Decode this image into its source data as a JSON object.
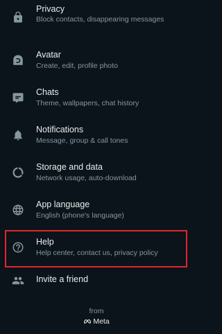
{
  "settings": {
    "items": [
      {
        "title": "Privacy",
        "subtitle": "Block contacts, disappearing messages",
        "icon": "lock-icon"
      },
      {
        "title": "Avatar",
        "subtitle": "Create, edit, profile photo",
        "icon": "avatar-icon"
      },
      {
        "title": "Chats",
        "subtitle": "Theme, wallpapers, chat history",
        "icon": "chat-icon"
      },
      {
        "title": "Notifications",
        "subtitle": "Message, group & call tones",
        "icon": "bell-icon"
      },
      {
        "title": "Storage and data",
        "subtitle": "Network usage, auto-download",
        "icon": "storage-icon"
      },
      {
        "title": "App language",
        "subtitle": "English (phone's language)",
        "icon": "globe-icon"
      },
      {
        "title": "Help",
        "subtitle": "Help center, contact us, privacy policy",
        "icon": "help-icon"
      },
      {
        "title": "Invite a friend",
        "icon": "people-icon"
      }
    ]
  },
  "footer": {
    "from_label": "from",
    "brand": "Meta"
  },
  "colors": {
    "background": "#0b141a",
    "title": "#e9edef",
    "subtitle": "#8696a0",
    "icon": "#8696a0",
    "highlight_border": "#e3262a"
  }
}
